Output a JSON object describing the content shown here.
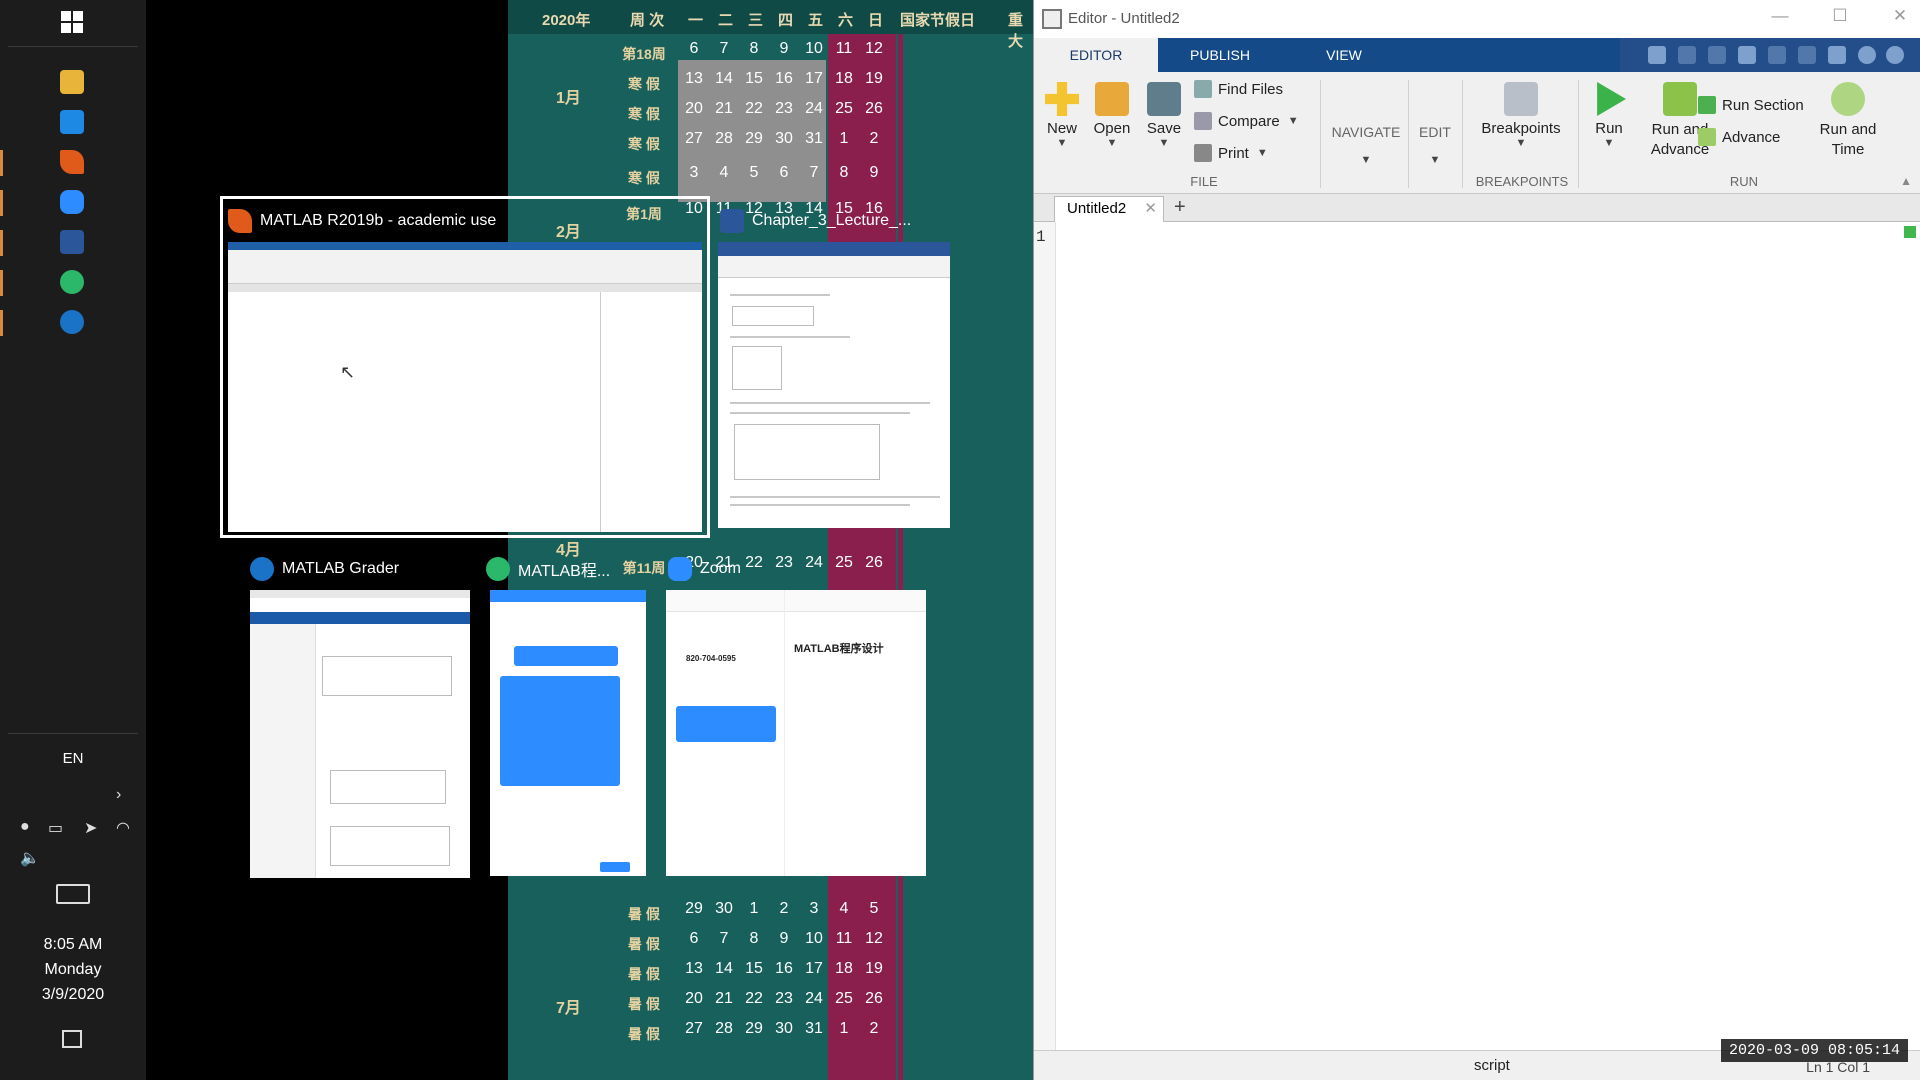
{
  "taskbar": {
    "language": "EN",
    "time": "8:05 AM",
    "day": "Monday",
    "date": "3/9/2020",
    "icons": [
      "windows-start-icon",
      "file-explorer-icon",
      "store-icon",
      "matlab-icon",
      "zoom-icon",
      "word-icon",
      "wechat-icon",
      "matlab-grader-icon"
    ]
  },
  "calendar": {
    "year_label": "2020年",
    "week_label": "周 次",
    "weekdays": [
      "一",
      "二",
      "三",
      "四",
      "五",
      "六",
      "日"
    ],
    "holiday_header": "国家节假日",
    "next_header": "重大",
    "months": [
      {
        "label": "1月",
        "row": 2
      },
      {
        "label": "2月",
        "row": 6
      },
      {
        "label": "4月",
        "row": 14
      },
      {
        "label": "7月",
        "row": 27
      }
    ],
    "weeks": [
      {
        "label": "第18周",
        "days": [
          "6",
          "7",
          "8",
          "9",
          "10",
          "11",
          "12"
        ]
      },
      {
        "label": "寒 假",
        "days": [
          "13",
          "14",
          "15",
          "16",
          "17",
          "18",
          "19"
        ]
      },
      {
        "label": "寒 假",
        "days": [
          "20",
          "21",
          "22",
          "23",
          "24",
          "25",
          "26"
        ]
      },
      {
        "label": "寒 假",
        "days": [
          "27",
          "28",
          "29",
          "30",
          "31",
          "1",
          "2"
        ]
      },
      {
        "label": "寒 假",
        "days": [
          "3",
          "4",
          "5",
          "6",
          "7",
          "8",
          "9"
        ]
      },
      {
        "label": "第1周",
        "days": [
          "10",
          "11",
          "12",
          "13",
          "14",
          "15",
          "16"
        ]
      },
      {
        "label": "第11周",
        "days": [
          "20",
          "21",
          "22",
          "23",
          "24",
          "25",
          "26"
        ]
      },
      {
        "label": "暑 假",
        "days": [
          "29",
          "30",
          "1",
          "2",
          "3",
          "4",
          "5"
        ]
      },
      {
        "label": "暑 假",
        "days": [
          "6",
          "7",
          "8",
          "9",
          "10",
          "11",
          "12"
        ]
      },
      {
        "label": "暑 假",
        "days": [
          "13",
          "14",
          "15",
          "16",
          "17",
          "18",
          "19"
        ]
      },
      {
        "label": "暑 假",
        "days": [
          "20",
          "21",
          "22",
          "23",
          "24",
          "25",
          "26"
        ]
      },
      {
        "label": "暑 假",
        "days": [
          "27",
          "28",
          "29",
          "30",
          "31",
          "1",
          "2"
        ]
      }
    ]
  },
  "switcher": {
    "matlab": {
      "title": "MATLAB R2019b - academic use"
    },
    "word": {
      "title": "Chapter_3_Lecture_..."
    },
    "grader": {
      "title": "MATLAB Grader"
    },
    "wechat": {
      "title": "MATLAB程..."
    },
    "zoom": {
      "title": "Zoom",
      "meeting_id": "820-704-0595",
      "meeting_name": "MATLAB程序设计"
    }
  },
  "editor": {
    "title": "Editor - Untitled2",
    "tabs": [
      "EDITOR",
      "PUBLISH",
      "VIEW"
    ],
    "file_section": {
      "label": "FILE",
      "new": "New",
      "open": "Open",
      "save": "Save",
      "find_files": "Find Files",
      "compare": "Compare",
      "print": "Print"
    },
    "navigate": "NAVIGATE",
    "edit": "EDIT",
    "breakpoints_section": {
      "label": "BREAKPOINTS",
      "breakpoints": "Breakpoints"
    },
    "run_section": {
      "label": "RUN",
      "run": "Run",
      "run_and_advance": "Run and Advance",
      "run_section": "Run Section",
      "advance": "Advance",
      "run_and_time": "Run and Time"
    },
    "doc_tab": "Untitled2",
    "line_number": "1",
    "status_mode": "script",
    "status_ln": "Ln  1   Col  1"
  },
  "timestamp": "2020-03-09 08:05:14",
  "colors": {
    "taskbar": "#1c1c1c",
    "calendar_bg": "#17605c",
    "ribbon_tab": "#154a88",
    "accent_indicator": "#d98a3a"
  }
}
